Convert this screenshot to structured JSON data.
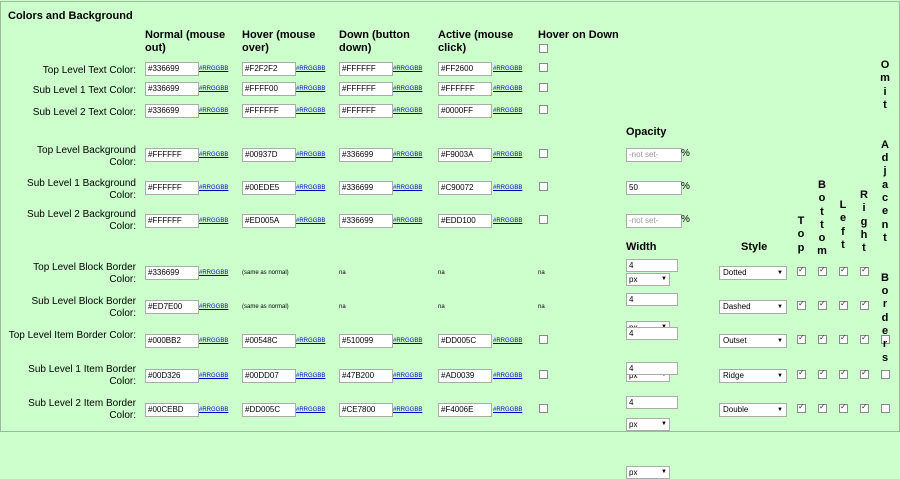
{
  "title": "Colors and Background",
  "columns": {
    "normal": "Normal (mouse out)",
    "hover": "Hover (mouse over)",
    "down": "Down (button down)",
    "active": "Active (mouse click)",
    "hover_on_down": "Hover on Down"
  },
  "link_label": "#RRGGBB",
  "na_label": "na",
  "same_as_normal": "(same as normal)",
  "opacity_label": "Opacity",
  "width_label": "Width",
  "style_label": "Style",
  "vertical": {
    "top": "Top",
    "bottom": "Bottom",
    "left": "Left",
    "right": "Right",
    "omit": "Omit Adjacent Borders"
  },
  "rows": [
    {
      "label": "Top Level Text Color:",
      "normal": "#336699",
      "hover": "#F2F2F2",
      "down": "#FFFFFF",
      "active": "#FF2600"
    },
    {
      "label": "Sub Level 1 Text Color:",
      "normal": "#336699",
      "hover": "#FFFF00",
      "down": "#FFFFFF",
      "active": "#FFFFFF"
    },
    {
      "label": "Sub Level 2 Text Color:",
      "normal": "#336699",
      "hover": "#FFFFFF",
      "down": "#FFFFFF",
      "active": "#0000FF"
    },
    {
      "label": "Top Level Background Color:",
      "normal": "#FFFFFF",
      "hover": "#00937D",
      "down": "#336699",
      "active": "#F9003A",
      "opacity": "",
      "opacity_placeholder": "-not set-"
    },
    {
      "label": "Sub Level 1 Background Color:",
      "normal": "#FFFFFF",
      "hover": "#00EDE5",
      "down": "#336699",
      "active": "#C90072",
      "opacity": "50",
      "opacity_placeholder": ""
    },
    {
      "label": "Sub Level 2 Background Color:",
      "normal": "#FFFFFF",
      "hover": "#ED005A",
      "down": "#336699",
      "active": "#EDD100",
      "opacity": "",
      "opacity_placeholder": "-not set-"
    },
    {
      "label": "Top Level Block Border Color:",
      "normal": "#336699",
      "width": "4",
      "unit": "px",
      "style": "Dotted"
    },
    {
      "label": "Sub Level Block Border Color:",
      "normal": "#ED7E00",
      "width": "4",
      "unit": "px",
      "style": "Dashed"
    },
    {
      "label": "Top Level Item Border Color:",
      "normal": "#000BB2",
      "hover": "#00548C",
      "down": "#510099",
      "active": "#DD005C",
      "width": "4",
      "unit": "px",
      "style": "Outset"
    },
    {
      "label": "Sub Level 1 Item Border Color:",
      "normal": "#00D326",
      "hover": "#00DD07",
      "down": "#47B200",
      "active": "#AD0039",
      "width": "4",
      "unit": "px",
      "style": "Ridge"
    },
    {
      "label": "Sub Level 2 Item Border Color:",
      "normal": "#00CEBD",
      "hover": "#DD005C",
      "down": "#CE7800",
      "active": "#F4006E",
      "width": "4",
      "unit": "px",
      "style": "Double"
    }
  ]
}
